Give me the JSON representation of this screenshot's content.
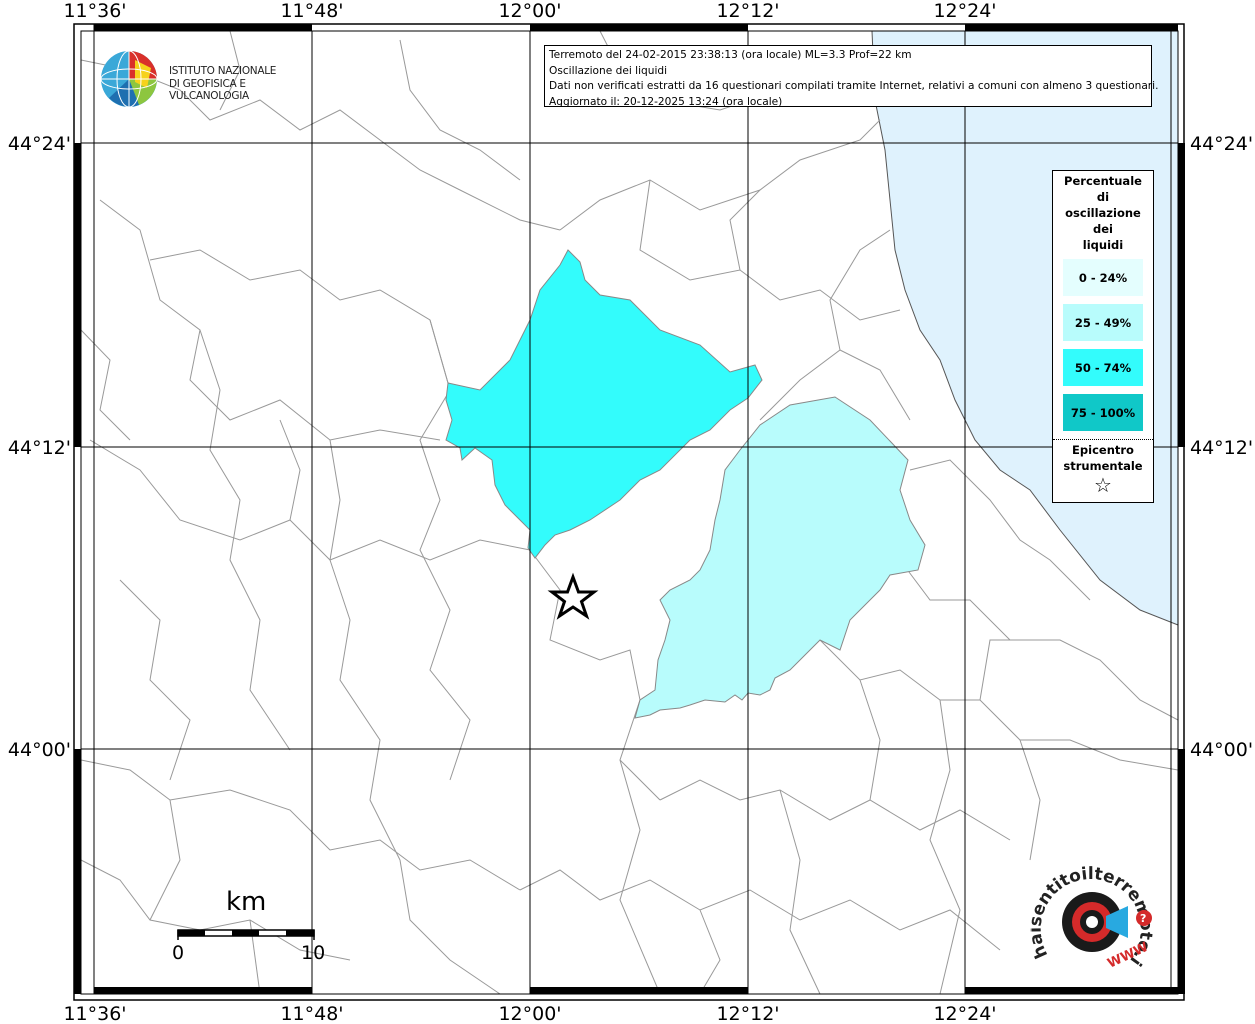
{
  "header": {
    "line1": "Terremoto del 24-02-2015 23:38:13 (ora locale) ML=3.3 Prof=22 km",
    "line2": "Oscillazione dei liquidi",
    "line3": "Dati non verificati estratti da 16 questionari compilati tramite Internet, relativi a comuni con almeno 3 questionari.",
    "line4": "Aggiornato il: 20-12-2025 13:24 (ora locale)"
  },
  "logo": {
    "line1": "ISTITUTO NAZIONALE",
    "line2": "DI GEOFISICA E VULCANOLOGIA"
  },
  "axes": {
    "top_labels": [
      "11°36'",
      "11°48'",
      "12°00'",
      "12°12'",
      "12°24'"
    ],
    "bottom_labels": [
      "11°36'",
      "11°48'",
      "12°00'",
      "12°12'",
      "12°24'"
    ],
    "left_labels": [
      "44°24'",
      "44°12'",
      "44°00'"
    ],
    "right_labels": [
      "44°24'",
      "44°12'",
      "44°00'"
    ]
  },
  "legend": {
    "title_lines": [
      "Percentuale",
      "di",
      "oscillazione",
      "dei",
      "liquidi"
    ],
    "classes": [
      {
        "label": "0 - 24%",
        "color": "#e4fefe"
      },
      {
        "label": "25 - 49%",
        "color": "#b8fcfc"
      },
      {
        "label": "50 - 74%",
        "color": "#33fcfc"
      },
      {
        "label": "75 - 100%",
        "color": "#10c8c8"
      }
    ],
    "epicenter_lines": [
      "Epicentro",
      "strumentale"
    ],
    "epicenter_symbol": "☆"
  },
  "scale": {
    "unit": "km",
    "min": "0",
    "max": "10"
  },
  "badge": {
    "text": "haisentitoilterremoto.it",
    "www": "WWW"
  },
  "colors": {
    "sea": "#dff2fd",
    "border": "#999999",
    "frame": "#000000"
  }
}
